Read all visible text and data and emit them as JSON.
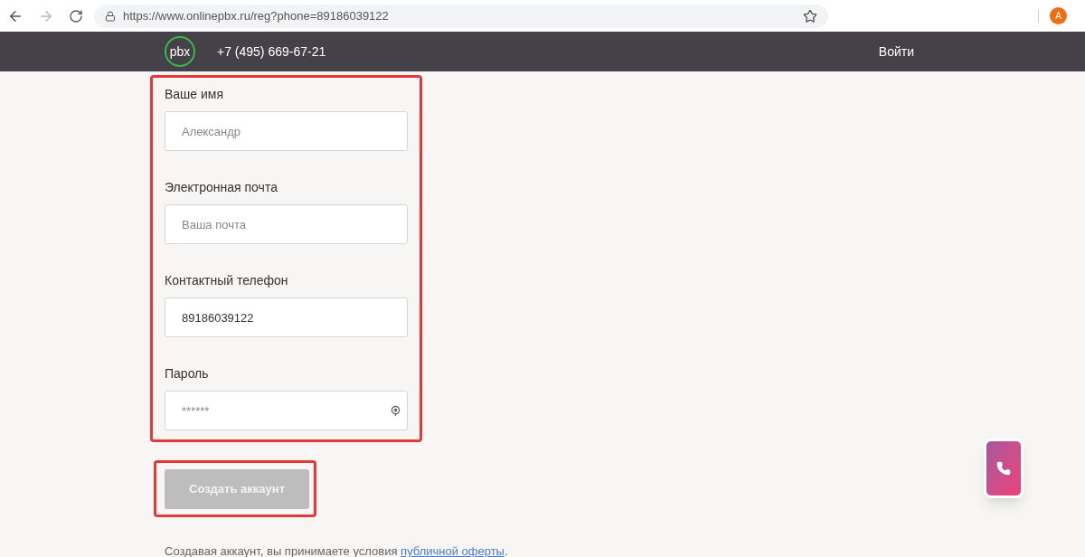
{
  "browser": {
    "url": "https://www.onlinepbx.ru/reg?phone=89186039122",
    "profile_initial": "A"
  },
  "header": {
    "logo": "pbx",
    "phone": "+7 (495) 669-67-21",
    "login": "Войти"
  },
  "form": {
    "fields": [
      {
        "label": "Ваше имя",
        "placeholder": "Александр"
      },
      {
        "label": "Электронная почта",
        "placeholder": "Ваша почта"
      },
      {
        "label": "Контактный телефон",
        "value": "89186039122"
      },
      {
        "label": "Пароль",
        "placeholder": "******",
        "kind": "password"
      }
    ],
    "submit": {
      "label": "Создать аккаунт",
      "disabled": true
    },
    "terms": {
      "text": "Создавая аккаунт, вы принимаете условия",
      "link": "публичной оферты",
      "end": "."
    }
  }
}
